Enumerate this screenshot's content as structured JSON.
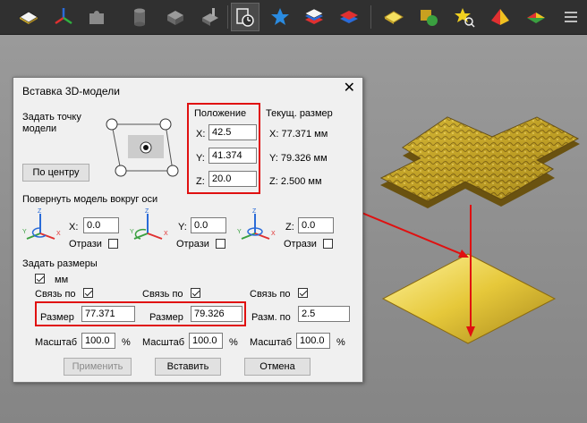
{
  "dialog": {
    "title": "Вставка 3D-модели",
    "close": "✕",
    "set_point_label": "Задать точку\nмодели",
    "center_button": "По центру",
    "position_header": "Положение",
    "current_size_header": "Текущ. размер",
    "pos": {
      "x_label": "X:",
      "x": "42.5",
      "y_label": "Y:",
      "y": "41.374",
      "z_label": "Z:",
      "z": "20.0"
    },
    "cur": {
      "x": "X:  77.371 мм",
      "y": "Y:  79.326 мм",
      "z": "Z:  2.500 мм"
    },
    "rotate_label": "Повернуть модель вокруг оси",
    "rotate": [
      {
        "axis": "X:",
        "value": "0.0",
        "mirror": "Отрази"
      },
      {
        "axis": "Y:",
        "value": "0.0",
        "mirror": "Отрази"
      },
      {
        "axis": "Z:",
        "value": "0.0",
        "mirror": "Отрази"
      }
    ],
    "sizes_label": "Задать размеры",
    "mm_label": "мм",
    "link_label": "Связь по",
    "size_label": "Размер",
    "size_x": "77.371",
    "size_y": "79.326",
    "size_z_label": "Разм. по",
    "size_z": "2.5",
    "scale_label": "Масштаб",
    "scale_unit": "%",
    "scale": [
      "100.0",
      "100.0",
      "100.0"
    ],
    "apply_button": "Применить",
    "insert_button": "Вставить",
    "cancel_button": "Отмена"
  },
  "toolbar": {
    "icons": [
      "flat-plane-icon",
      "axes-icon",
      "puzzle-icon",
      "cylinder-icon",
      "box-icon",
      "box-edit-icon",
      "clock-icon",
      "star-icon",
      "layers-icon",
      "layers-red-icon",
      "gold-plane-icon",
      "shapes-icon",
      "star-search-icon",
      "pyramid-icon",
      "color-plane-icon",
      "list-icon"
    ]
  },
  "colors": {
    "accent_red": "#e01010",
    "gold": "#d4b82a"
  }
}
